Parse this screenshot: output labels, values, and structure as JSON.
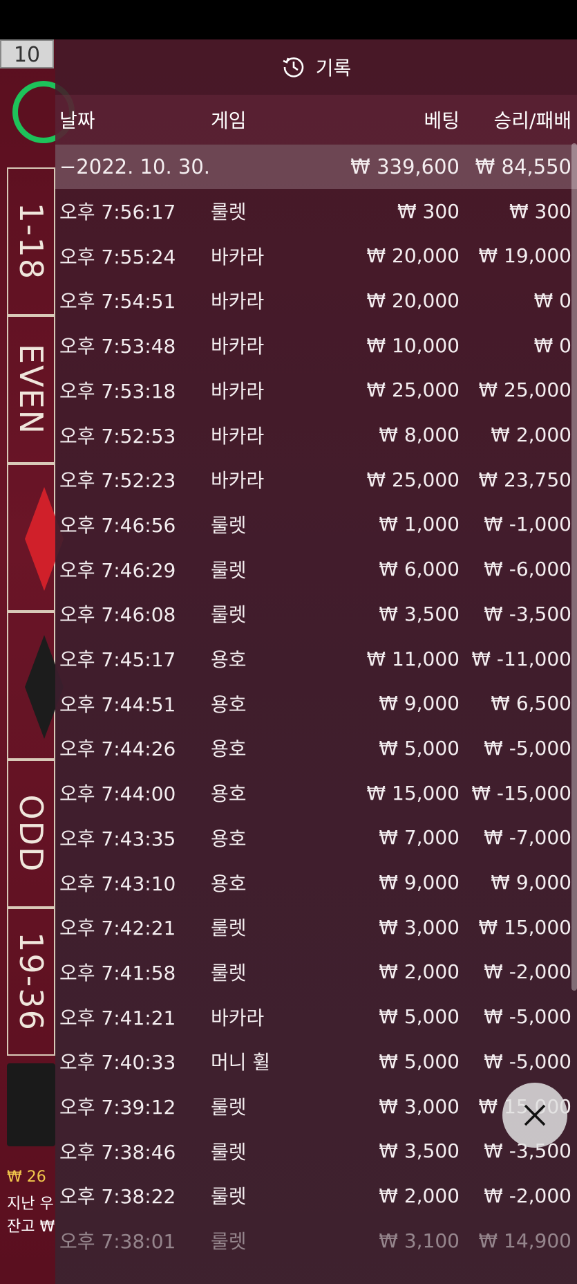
{
  "status_bar": {},
  "board": {
    "round_number": "10",
    "bets": [
      "1-18",
      "EVEN",
      "",
      "",
      "ODD",
      "19-36"
    ],
    "balance_lines": [
      {
        "text": "₩ 26",
        "gold": true
      },
      {
        "text": "지난 우",
        "gold": false
      },
      {
        "text": "잔고 ₩",
        "gold": false
      }
    ]
  },
  "history": {
    "title": "기록",
    "columns": {
      "date": "날짜",
      "game": "게임",
      "bet": "베팅",
      "win_loss": "승리/패배"
    },
    "date_group": {
      "date": "−2022. 10. 30.",
      "bet": "₩ 339,600",
      "win_loss": "₩ 84,550"
    },
    "rows": [
      {
        "time": "오후 7:56:17",
        "game": "룰렛",
        "bet": "₩ 300",
        "win_loss": "₩ 300"
      },
      {
        "time": "오후 7:55:24",
        "game": "바카라",
        "bet": "₩ 20,000",
        "win_loss": "₩ 19,000"
      },
      {
        "time": "오후 7:54:51",
        "game": "바카라",
        "bet": "₩ 20,000",
        "win_loss": "₩ 0"
      },
      {
        "time": "오후 7:53:48",
        "game": "바카라",
        "bet": "₩ 10,000",
        "win_loss": "₩ 0"
      },
      {
        "time": "오후 7:53:18",
        "game": "바카라",
        "bet": "₩ 25,000",
        "win_loss": "₩ 25,000"
      },
      {
        "time": "오후 7:52:53",
        "game": "바카라",
        "bet": "₩ 8,000",
        "win_loss": "₩ 2,000"
      },
      {
        "time": "오후 7:52:23",
        "game": "바카라",
        "bet": "₩ 25,000",
        "win_loss": "₩ 23,750"
      },
      {
        "time": "오후 7:46:56",
        "game": "룰렛",
        "bet": "₩ 1,000",
        "win_loss": "₩ -1,000"
      },
      {
        "time": "오후 7:46:29",
        "game": "룰렛",
        "bet": "₩ 6,000",
        "win_loss": "₩ -6,000"
      },
      {
        "time": "오후 7:46:08",
        "game": "룰렛",
        "bet": "₩ 3,500",
        "win_loss": "₩ -3,500"
      },
      {
        "time": "오후 7:45:17",
        "game": "용호",
        "bet": "₩ 11,000",
        "win_loss": "₩ -11,000"
      },
      {
        "time": "오후 7:44:51",
        "game": "용호",
        "bet": "₩ 9,000",
        "win_loss": "₩ 6,500"
      },
      {
        "time": "오후 7:44:26",
        "game": "용호",
        "bet": "₩ 5,000",
        "win_loss": "₩ -5,000"
      },
      {
        "time": "오후 7:44:00",
        "game": "용호",
        "bet": "₩ 15,000",
        "win_loss": "₩ -15,000"
      },
      {
        "time": "오후 7:43:35",
        "game": "용호",
        "bet": "₩ 7,000",
        "win_loss": "₩ -7,000"
      },
      {
        "time": "오후 7:43:10",
        "game": "용호",
        "bet": "₩ 9,000",
        "win_loss": "₩ 9,000"
      },
      {
        "time": "오후 7:42:21",
        "game": "룰렛",
        "bet": "₩ 3,000",
        "win_loss": "₩ 15,000"
      },
      {
        "time": "오후 7:41:58",
        "game": "룰렛",
        "bet": "₩ 2,000",
        "win_loss": "₩ -2,000"
      },
      {
        "time": "오후 7:41:21",
        "game": "바카라",
        "bet": "₩ 5,000",
        "win_loss": "₩ -5,000"
      },
      {
        "time": "오후 7:40:33",
        "game": "머니 휠",
        "bet": "₩ 5,000",
        "win_loss": "₩ -5,000"
      },
      {
        "time": "오후 7:39:12",
        "game": "룰렛",
        "bet": "₩ 3,000",
        "win_loss": "₩ 15,000"
      },
      {
        "time": "오후 7:38:46",
        "game": "룰렛",
        "bet": "₩ 3,500",
        "win_loss": "₩ -3,500"
      },
      {
        "time": "오후 7:38:22",
        "game": "룰렛",
        "bet": "₩ 2,000",
        "win_loss": "₩ -2,000"
      },
      {
        "time": "오후 7:38:01",
        "game": "룰렛",
        "bet": "₩ 3,100",
        "win_loss": "₩ 14,900"
      }
    ],
    "close_icon": "close-icon"
  },
  "colors": {
    "accent_green": "#1ec25a",
    "board_red": "#6a1527",
    "gold": "#f2c94c"
  }
}
